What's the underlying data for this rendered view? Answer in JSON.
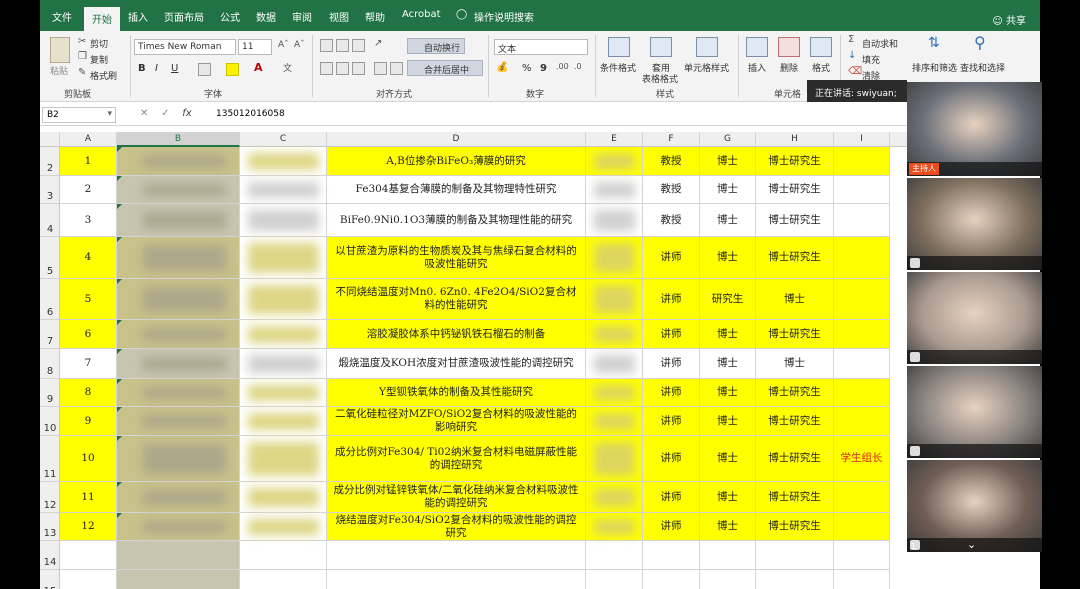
{
  "tabs": [
    "文件",
    "开始",
    "插入",
    "页面布局",
    "公式",
    "数据",
    "审阅",
    "视图",
    "帮助",
    "Acrobat",
    "操作说明搜索"
  ],
  "active_tab": "开始",
  "share_label": "共享",
  "ribbon": {
    "clipboard": {
      "paste": "粘贴",
      "cut": "剪切",
      "copy": "复制",
      "format_painter": "格式刷",
      "label": "剪贴板"
    },
    "font": {
      "name": "Times New Roman",
      "size": "11",
      "bold": "B",
      "italic": "I",
      "underline": "U",
      "label": "字体"
    },
    "alignment": {
      "wrap": "自动换行",
      "merge": "合并后居中",
      "label": "对齐方式"
    },
    "number": {
      "format": "文本",
      "percent": "%",
      "comma": "9",
      "label": "数字"
    },
    "styles": {
      "conditional": "条件格式",
      "table_1": "套用",
      "table_2": "表格格式",
      "cell_styles": "单元格样式",
      "label": "样式"
    },
    "cells": {
      "insert": "插入",
      "delete": "删除",
      "format": "格式",
      "label": "单元格"
    },
    "editing": {
      "autosum": "自动求和",
      "fill": "填充",
      "clear": "清除",
      "sort": "排序和筛选",
      "find": "查找和选择"
    }
  },
  "formula_bar": {
    "cell_ref": "B2",
    "fx": "fx",
    "value": "135012016058"
  },
  "columns": [
    "A",
    "B",
    "C",
    "D",
    "E",
    "F",
    "G",
    "H",
    "I"
  ],
  "rows": [
    {
      "num": "2",
      "a": "1",
      "d": "A,B位掺杂BiFeO₃薄膜的研究",
      "f": "教授",
      "g": "博士",
      "h": "博士研究生",
      "i": "",
      "yellow": true
    },
    {
      "num": "3",
      "a": "2",
      "d": "Fe304基复合薄膜的制备及其物理特性研究",
      "f": "教授",
      "g": "博士",
      "h": "博士研究生",
      "i": "",
      "yellow": false
    },
    {
      "num": "4",
      "a": "3",
      "d": "BiFe0.9Ni0.1O3薄膜的制备及其物理性能的研究",
      "f": "教授",
      "g": "博士",
      "h": "博士研究生",
      "i": "",
      "yellow": false
    },
    {
      "num": "5",
      "a": "4",
      "d": "以甘蔗渣为原料的生物质炭及其与焦绿石复合材料的吸波性能研究",
      "f": "讲师",
      "g": "博士",
      "h": "博士研究生",
      "i": "",
      "yellow": true
    },
    {
      "num": "6",
      "a": "5",
      "d": "不同烧结温度对Mn0. 6Zn0. 4Fe2O4/SiO2复合材料的性能研究",
      "f": "讲师",
      "g": "研究生",
      "h": "博士",
      "i": "",
      "yellow": true
    },
    {
      "num": "7",
      "a": "6",
      "d": "溶胶凝胶体系中钙铋钒铁石榴石的制备",
      "f": "讲师",
      "g": "博士",
      "h": "博士研究生",
      "i": "",
      "yellow": true
    },
    {
      "num": "8",
      "a": "7",
      "d": "煅烧温度及KOH浓度对甘蔗渣吸波性能的调控研究",
      "f": "讲师",
      "g": "博士",
      "h": "博士",
      "i": "",
      "yellow": false
    },
    {
      "num": "9",
      "a": "8",
      "d": "Y型钡铁氧体的制备及其性能研究",
      "f": "讲师",
      "g": "博士",
      "h": "博士研究生",
      "i": "",
      "yellow": true
    },
    {
      "num": "10",
      "a": "9",
      "d": "二氧化硅粒径对MZFO/SiO2复合材料的吸波性能的影响研究",
      "f": "讲师",
      "g": "博士",
      "h": "博士研究生",
      "i": "",
      "yellow": true
    },
    {
      "num": "11",
      "a": "10",
      "d": "成分比例对Fe304/ Ti02纳米复合材料电磁屏蔽性能的调控研究",
      "f": "讲师",
      "g": "博士",
      "h": "博士研究生",
      "i": "学生组长",
      "yellow": true
    },
    {
      "num": "12",
      "a": "11",
      "d": "成分比例对锰锌铁氧体/二氧化硅纳米复合材料吸波性能的调控研究",
      "f": "讲师",
      "g": "博士",
      "h": "博士研究生",
      "i": "",
      "yellow": true
    },
    {
      "num": "13",
      "a": "12",
      "d": "烧结温度对Fe304/SiO2复合材料的吸波性能的调控研究",
      "f": "讲师",
      "g": "博士",
      "h": "博士研究生",
      "i": "",
      "yellow": true
    },
    {
      "num": "14",
      "a": "",
      "d": "",
      "f": "",
      "g": "",
      "h": "",
      "i": "",
      "yellow": false
    },
    {
      "num": "15",
      "a": "",
      "d": "",
      "f": "",
      "g": "",
      "h": "",
      "i": "",
      "yellow": false
    }
  ],
  "meeting": {
    "speaking": "正在讲话: swiyuan;",
    "host_tag": "主持人",
    "tile_colors": [
      "#6a6f78",
      "#7e6f5f",
      "#a99a8f",
      "#8a8480",
      "#705e55"
    ],
    "page_indicator": "1"
  }
}
